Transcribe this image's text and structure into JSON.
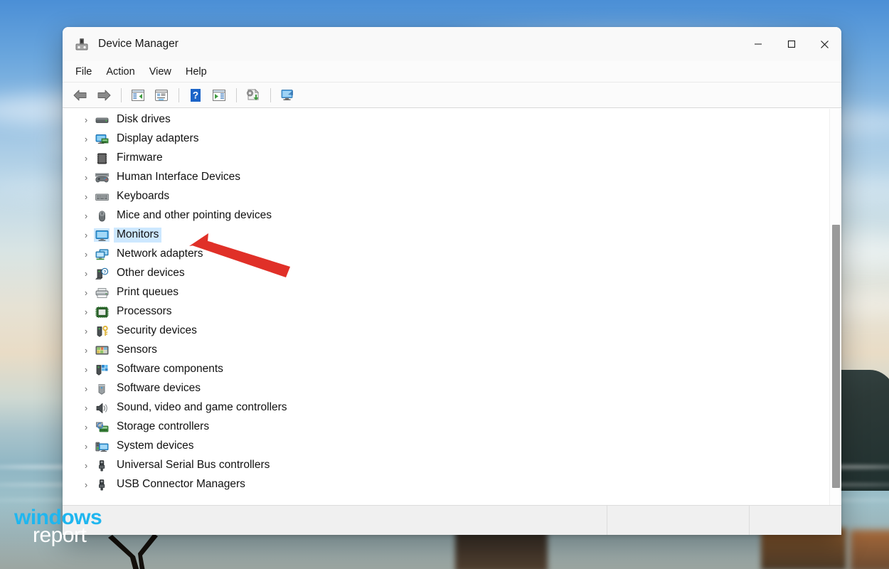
{
  "window": {
    "title": "Device Manager",
    "app_icon": "device-manager-icon",
    "controls": {
      "minimize": "—",
      "maximize": "☐",
      "close": "✕"
    }
  },
  "menubar": {
    "items": [
      {
        "label": "File"
      },
      {
        "label": "Action"
      },
      {
        "label": "View"
      },
      {
        "label": "Help"
      }
    ]
  },
  "toolbar": {
    "buttons": [
      {
        "name": "back-icon",
        "tooltip": "Back"
      },
      {
        "name": "forward-icon",
        "tooltip": "Forward"
      },
      {
        "name": "show-hide-console-tree-icon",
        "tooltip": "Show/Hide Console Tree"
      },
      {
        "name": "properties-icon",
        "tooltip": "Properties"
      },
      {
        "name": "help-icon",
        "tooltip": "Help"
      },
      {
        "name": "scan-for-hardware-changes-icon",
        "tooltip": "Scan for hardware changes"
      },
      {
        "name": "update-driver-icon",
        "tooltip": "Update driver"
      },
      {
        "name": "display-devices-icon",
        "tooltip": "Display devices"
      }
    ]
  },
  "tree": {
    "items": [
      {
        "label": "Disk drives",
        "icon": "disk-drive-icon",
        "expander": "›",
        "selected": false
      },
      {
        "label": "Display adapters",
        "icon": "display-adapter-icon",
        "expander": "›",
        "selected": false
      },
      {
        "label": "Firmware",
        "icon": "firmware-chip-icon",
        "expander": "›",
        "selected": false
      },
      {
        "label": "Human Interface Devices",
        "icon": "hid-gamepad-icon",
        "expander": "›",
        "selected": false
      },
      {
        "label": "Keyboards",
        "icon": "keyboard-icon",
        "expander": "›",
        "selected": false
      },
      {
        "label": "Mice and other pointing devices",
        "icon": "mouse-icon",
        "expander": "›",
        "selected": false
      },
      {
        "label": "Monitors",
        "icon": "monitor-icon",
        "expander": "›",
        "selected": true
      },
      {
        "label": "Network adapters",
        "icon": "network-adapter-icon",
        "expander": "›",
        "selected": false
      },
      {
        "label": "Other devices",
        "icon": "other-device-question-icon",
        "expander": "›",
        "selected": false
      },
      {
        "label": "Print queues",
        "icon": "printer-icon",
        "expander": "›",
        "selected": false
      },
      {
        "label": "Processors",
        "icon": "processor-icon",
        "expander": "›",
        "selected": false
      },
      {
        "label": "Security devices",
        "icon": "security-key-icon",
        "expander": "›",
        "selected": false
      },
      {
        "label": "Sensors",
        "icon": "sensors-icon",
        "expander": "›",
        "selected": false
      },
      {
        "label": "Software components",
        "icon": "software-component-icon",
        "expander": "›",
        "selected": false
      },
      {
        "label": "Software devices",
        "icon": "software-device-icon",
        "expander": "›",
        "selected": false
      },
      {
        "label": "Sound, video and game controllers",
        "icon": "sound-speaker-icon",
        "expander": "›",
        "selected": false
      },
      {
        "label": "Storage controllers",
        "icon": "storage-controller-icon",
        "expander": "›",
        "selected": false
      },
      {
        "label": "System devices",
        "icon": "system-device-icon",
        "expander": "›",
        "selected": false
      },
      {
        "label": "Universal Serial Bus controllers",
        "icon": "usb-icon",
        "expander": "›",
        "selected": false
      },
      {
        "label": "USB Connector Managers",
        "icon": "usb-icon",
        "expander": "›",
        "selected": false
      }
    ]
  },
  "statusbar": {
    "main_text": "",
    "pane2_text": "",
    "pane3_text": ""
  },
  "annotation": {
    "arrow_color": "#e03028",
    "points_at": "Monitors"
  },
  "watermark": {
    "line1": "windows",
    "line2": "report",
    "line1_color": "#1fb6ef",
    "line2_color": "#ffffff"
  },
  "colors": {
    "selection": "#cde8ff",
    "titlebar": "#f9f9f9",
    "statusbar": "#f0f0f0",
    "scrollbar_thumb": "#9a9a9a"
  }
}
